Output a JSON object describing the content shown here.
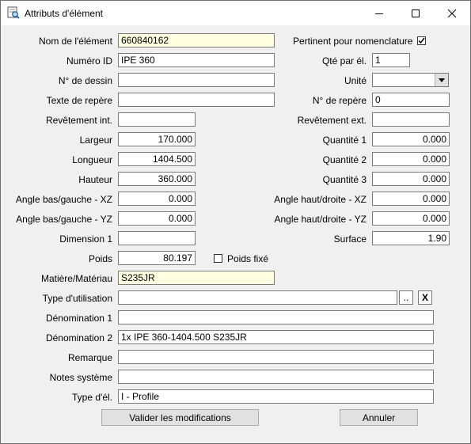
{
  "window": {
    "title": "Attributs d'élément",
    "minimize_icon": "minimize-icon",
    "maximize_icon": "maximize-icon",
    "close_icon": "close-icon"
  },
  "labels": {
    "nom": "Nom de l'élément",
    "numero_id": "Numéro ID",
    "n_dessin": "N° de dessin",
    "texte_repere": "Texte de repère",
    "revetement_int": "Revêtement int.",
    "largeur": "Largeur",
    "longueur": "Longueur",
    "hauteur": "Hauteur",
    "angle_bg_xz": "Angle bas/gauche - XZ",
    "angle_bg_yz": "Angle bas/gauche - YZ",
    "dimension1": "Dimension 1",
    "poids": "Poids",
    "poids_fixe": "Poids fixé",
    "matiere": "Matière/Matériau",
    "type_utilisation": "Type d'utilisation",
    "denomination1": "Dénomination 1",
    "denomination2": "Dénomination 2",
    "remarque": "Remarque",
    "notes_systeme": "Notes système",
    "type_el": "Type d'él.",
    "pertinent": "Pertinent pour nomenclature",
    "qte_par_el": "Qté par él.",
    "unite": "Unité",
    "n_repere": "N° de repère",
    "revetement_ext": "Revêtement ext.",
    "quantite1": "Quantité 1",
    "quantite2": "Quantité 2",
    "quantite3": "Quantité 3",
    "angle_hd_xz": "Angle haut/droite - XZ",
    "angle_hd_yz": "Angle haut/droite - YZ",
    "surface": "Surface"
  },
  "values": {
    "nom": "660840162",
    "numero_id": "IPE 360",
    "n_dessin": "",
    "texte_repere": "",
    "revetement_int": "",
    "largeur": "170.000",
    "longueur": "1404.500",
    "hauteur": "360.000",
    "angle_bg_xz": "0.000",
    "angle_bg_yz": "0.000",
    "dimension1": "",
    "poids": "80.197",
    "matiere": "S235JR",
    "type_utilisation": "",
    "denomination1": "",
    "denomination2": "1x IPE 360-1404.500 S235JR",
    "remarque": "",
    "notes_systeme": "",
    "type_el": "I - Profile",
    "qte_par_el": "1",
    "unite": "",
    "n_repere": "0",
    "revetement_ext": "",
    "quantite1": "0.000",
    "quantite2": "0.000",
    "quantite3": "0.000",
    "angle_hd_xz": "0.000",
    "angle_hd_yz": "0.000",
    "surface": "1.90",
    "pertinent_checked": true,
    "poids_fixe_checked": false
  },
  "buttons": {
    "browse": "..",
    "clear": "X",
    "validate": "Valider les modifications",
    "cancel": "Annuler"
  }
}
